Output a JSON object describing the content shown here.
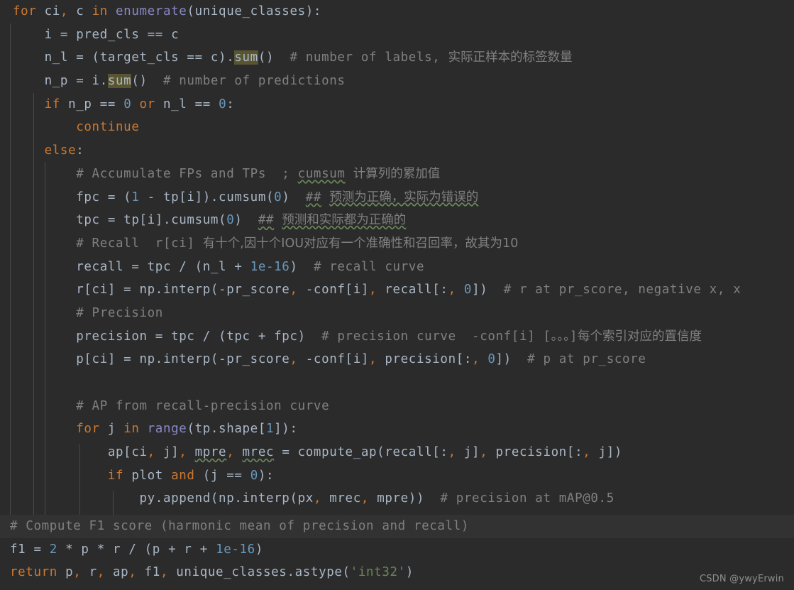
{
  "editor": {
    "theme": "darcula",
    "background": "#2b2b2b",
    "highlight_line_background": "#323232",
    "occurrence_highlight_color": "#5a5531",
    "colors": {
      "default_text": "#a9b7c6",
      "keyword": "#cc7832",
      "number": "#6897bb",
      "comment": "#808080",
      "string": "#6a8759",
      "builtin": "#8888c6",
      "indent_guide": "#4a4a4a",
      "squiggle": "#6a8759"
    }
  },
  "code": {
    "language": "python",
    "lines": [
      {
        "id": "line-for-ci",
        "text": "for ci, c in enumerate(unique_classes):"
      },
      {
        "id": "line-i-pred-cls",
        "text": "    i = pred_cls == c"
      },
      {
        "id": "line-n-l",
        "text": "    n_l = (target_cls == c).sum()  # number of labels, 实际正样本的标签数量"
      },
      {
        "id": "line-n-p",
        "text": "    n_p = i.sum()  # number of predictions"
      },
      {
        "id": "line-if-np",
        "text": "    if n_p == 0 or n_l == 0:"
      },
      {
        "id": "line-continue",
        "text": "        continue"
      },
      {
        "id": "line-else",
        "text": "    else:"
      },
      {
        "id": "line-accumulate-comment",
        "text": "        # Accumulate FPs and TPs  ; cumsum 计算列的累加值"
      },
      {
        "id": "line-fpc",
        "text": "        fpc = (1 - tp[i]).cumsum(0)  ## 预测为正确，实际为错误的"
      },
      {
        "id": "line-tpc",
        "text": "        tpc = tp[i].cumsum(0)  ## 预测和实际都为正确的"
      },
      {
        "id": "line-recall-comment",
        "text": "        # Recall  r[ci] 有十个,因十个IOU对应有一个准确性和召回率，故其为10"
      },
      {
        "id": "line-recall",
        "text": "        recall = tpc / (n_l + 1e-16)  # recall curve"
      },
      {
        "id": "line-r-ci",
        "text": "        r[ci] = np.interp(-pr_score, -conf[i], recall[:, 0])  # r at pr_score, negative x, x"
      },
      {
        "id": "line-precision-comment",
        "text": "        # Precision"
      },
      {
        "id": "line-precision",
        "text": "        precision = tpc / (tpc + fpc)  # precision curve  -conf[i] [。。。]每个索引对应的置信度"
      },
      {
        "id": "line-p-ci",
        "text": "        p[ci] = np.interp(-pr_score, -conf[i], precision[:, 0])  # p at pr_score"
      },
      {
        "id": "line-blank",
        "text": ""
      },
      {
        "id": "line-ap-comment",
        "text": "        # AP from recall-precision curve"
      },
      {
        "id": "line-for-j",
        "text": "        for j in range(tp.shape[1]):"
      },
      {
        "id": "line-ap-ci-j",
        "text": "            ap[ci, j], mpre, mrec = compute_ap(recall[:, j], precision[:, j])"
      },
      {
        "id": "line-if-plot",
        "text": "            if plot and (j == 0):"
      },
      {
        "id": "line-py-append",
        "text": "                py.append(np.interp(px, mrec, mpre))  # precision at mAP@0.5"
      }
    ],
    "footer_lines": [
      {
        "id": "line-f1-comment",
        "text": "# Compute F1 score (harmonic mean of precision and recall)",
        "highlighted": true
      },
      {
        "id": "line-f1",
        "text": "f1 = 2 * p * r / (p + r + 1e-16)",
        "highlighted": false
      },
      {
        "id": "line-return",
        "text": "return p, r, ap, f1, unique_classes.astype('int32')",
        "highlighted": false
      }
    ]
  },
  "occurrence_highlights": [
    "sum",
    "sum"
  ],
  "spellcheck_underlined": [
    "cumsum",
    "预测为正确，实际为错误的",
    "预测和实际都为正确的",
    "mpre",
    "mrec"
  ],
  "watermark": {
    "text": "CSDN @ywyErwin"
  }
}
